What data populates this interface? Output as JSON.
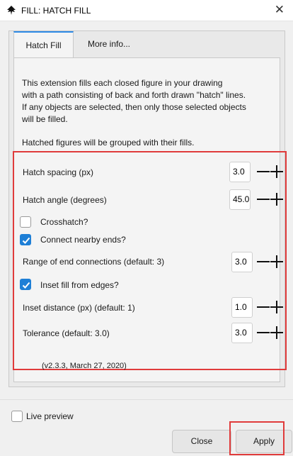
{
  "window": {
    "title": "FILL: HATCH FILL",
    "icon": "inkscape-icon",
    "close_icon": "close-icon"
  },
  "tabs": [
    {
      "label": "Hatch Fill",
      "active": true
    },
    {
      "label": "More info..."
    }
  ],
  "description": [
    "This extension fills each closed figure in your drawing",
    "with a path consisting of back and forth drawn \"hatch\" lines.",
    "If any objects are selected, then only those selected objects",
    "will be filled."
  ],
  "grouped_note": "Hatched figures will be grouped with their fills.",
  "params": {
    "hatch_spacing": {
      "label": "Hatch spacing (px)",
      "value": "3.0"
    },
    "hatch_angle": {
      "label": "Hatch angle (degrees)",
      "value": "45.0"
    },
    "crosshatch": {
      "label": "Crosshatch?",
      "checked": false
    },
    "connect_ends": {
      "label": "Connect nearby ends?",
      "checked": true
    },
    "range_end": {
      "label": "Range of end connections (default: 3)",
      "value": "3.0"
    },
    "inset_fill": {
      "label": "Inset fill from edges?",
      "checked": true
    },
    "inset_distance": {
      "label": "Inset distance (px) (default: 1)",
      "value": "1.0"
    },
    "tolerance": {
      "label": "Tolerance (default: 3.0)",
      "value": "3.0"
    }
  },
  "version": "(v2.3.3, March 27, 2020)",
  "live_preview": {
    "label": "Live preview",
    "checked": false
  },
  "buttons": {
    "close": "Close",
    "apply": "Apply"
  },
  "colors": {
    "accent": "#1e7fd6",
    "highlight": "#e03b3b",
    "tab_active": "#2e8be6"
  }
}
